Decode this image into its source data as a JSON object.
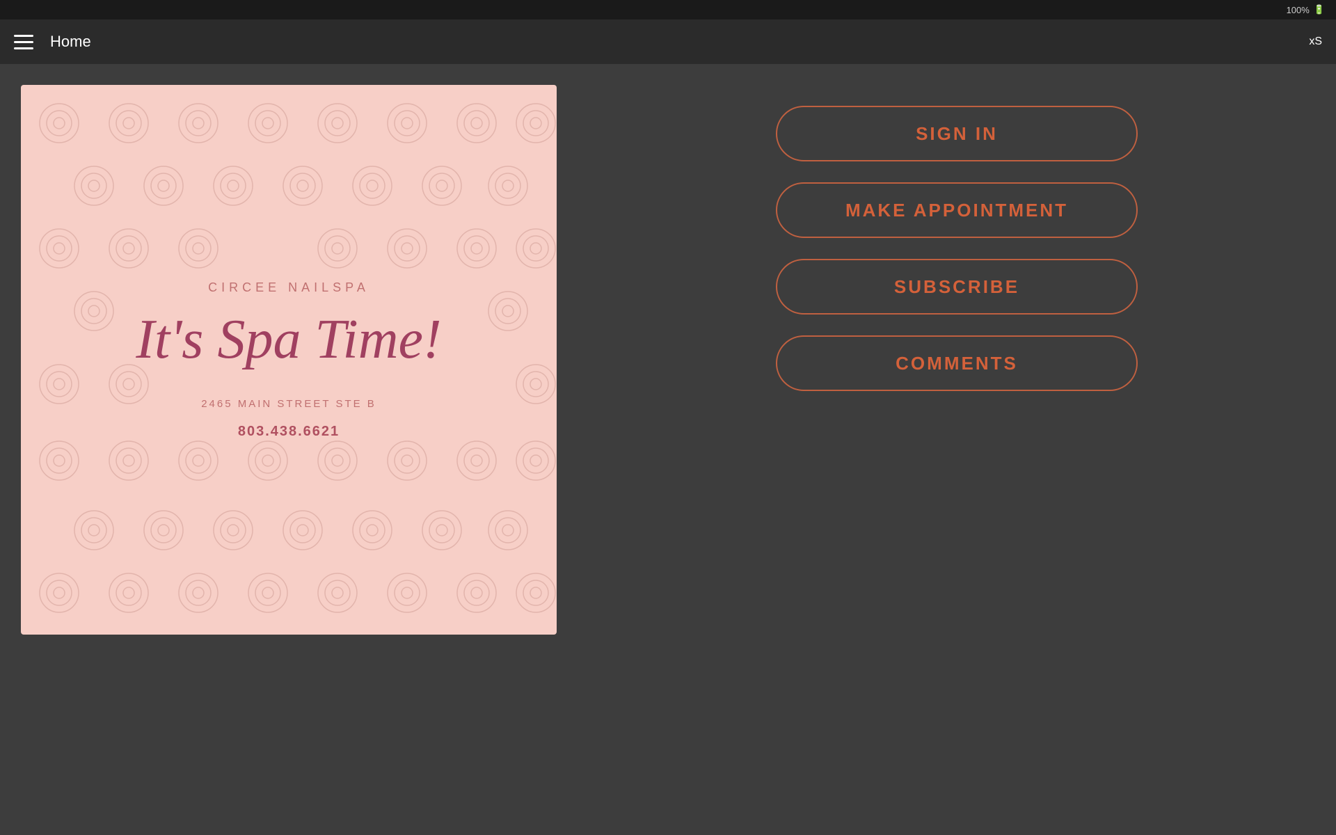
{
  "statusBar": {
    "batteryText": "100%",
    "batteryIcon": "battery-icon"
  },
  "navBar": {
    "title": "Home",
    "menuIcon": "hamburger-icon",
    "rightLabel": "xS"
  },
  "spaCard": {
    "brandName": "CIRCEE NAILSPA",
    "tagline": "It's Spa Time!",
    "address": "2465 MAIN STREET STE B",
    "phone": "803.438.6621",
    "backgroundColor": "#f7cfc7"
  },
  "buttons": [
    {
      "id": "sign-in",
      "label": "SIGN IN"
    },
    {
      "id": "make-appointment",
      "label": "MAKE APPOINTMENT"
    },
    {
      "id": "subscribe",
      "label": "SUBSCRIBE"
    },
    {
      "id": "comments",
      "label": "COMMENTS"
    }
  ],
  "colors": {
    "accent": "#d4613a",
    "border": "#c06040",
    "navBg": "#2b2b2b",
    "statusBg": "#1a1a1a",
    "mainBg": "#3d3d3d",
    "spaCardBg": "#f7cfc7",
    "spaBrandColor": "#c07070",
    "spaTaglineColor": "#a04060",
    "spaAddressColor": "#c07070",
    "spaPhoneColor": "#b05060"
  }
}
